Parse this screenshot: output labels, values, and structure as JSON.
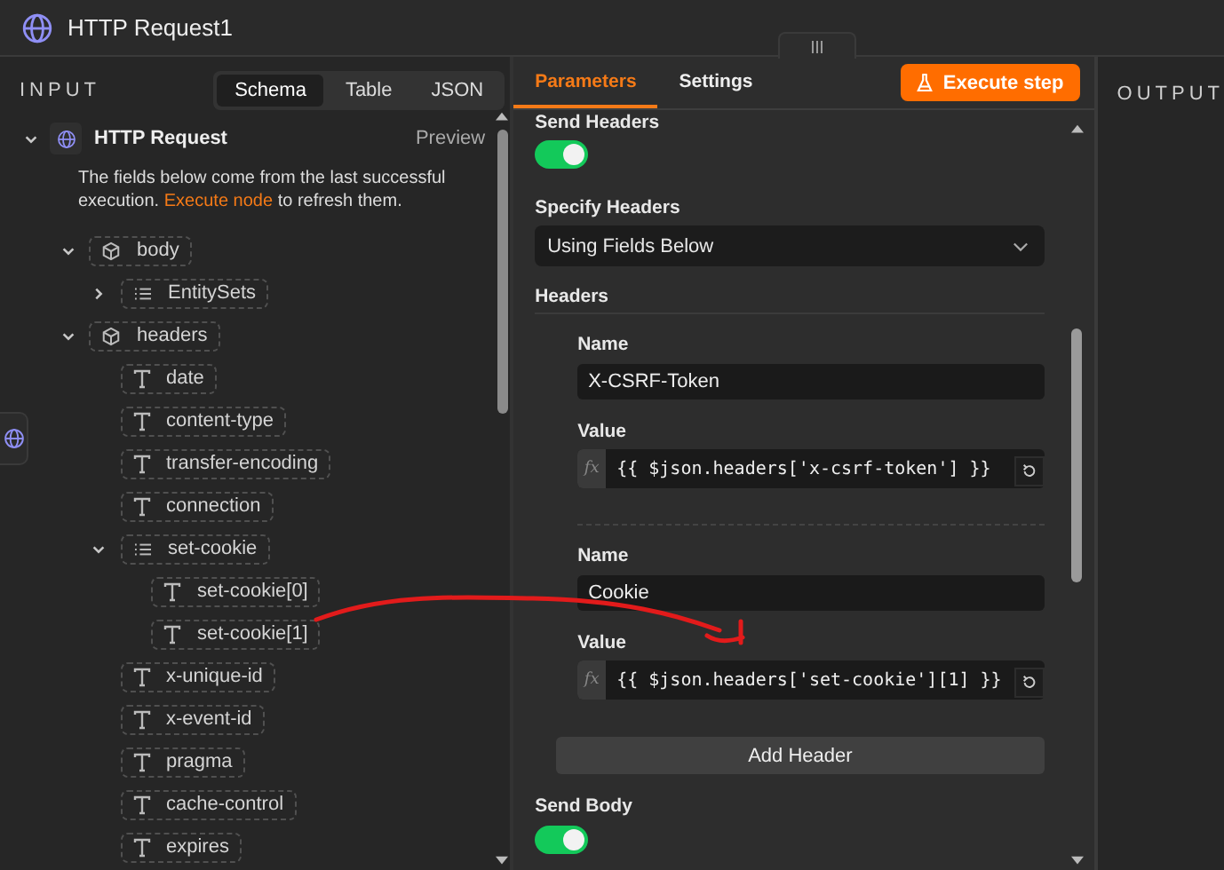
{
  "window": {
    "title": "HTTP Request1"
  },
  "input_panel": {
    "title": "INPUT",
    "view_tabs": [
      {
        "label": "Schema",
        "selected": true
      },
      {
        "label": "Table",
        "selected": false
      },
      {
        "label": "JSON",
        "selected": false
      }
    ],
    "node": {
      "name": "HTTP Request",
      "expanded": true,
      "preview": "Preview"
    },
    "notice": {
      "before": "The fields below come from the last successful execution.",
      "link": "Execute node",
      "after": "to refresh them."
    },
    "fields": [
      {
        "name": "body",
        "kind": "object",
        "expanded": true,
        "children": [
          {
            "name": "EntitySets",
            "kind": "array",
            "expanded": false
          }
        ]
      },
      {
        "name": "headers",
        "kind": "object",
        "expanded": true,
        "children": [
          {
            "name": "date",
            "kind": "string"
          },
          {
            "name": "content-type",
            "kind": "string"
          },
          {
            "name": "transfer-encoding",
            "kind": "string"
          },
          {
            "name": "connection",
            "kind": "string"
          },
          {
            "name": "set-cookie",
            "kind": "array",
            "expanded": true,
            "children": [
              {
                "name": "set-cookie[0]",
                "kind": "string"
              },
              {
                "name": "set-cookie[1]",
                "kind": "string"
              }
            ]
          },
          {
            "name": "x-unique-id",
            "kind": "string"
          },
          {
            "name": "x-event-id",
            "kind": "string"
          },
          {
            "name": "pragma",
            "kind": "string"
          },
          {
            "name": "cache-control",
            "kind": "string"
          },
          {
            "name": "expires",
            "kind": "string"
          }
        ]
      }
    ]
  },
  "parameters_panel": {
    "tabs": [
      {
        "label": "Parameters",
        "selected": true
      },
      {
        "label": "Settings",
        "selected": false
      }
    ],
    "execute_button": "Execute step",
    "send_headers": {
      "label": "Send Headers",
      "on": true
    },
    "specify_headers": {
      "label": "Specify Headers",
      "value": "Using Fields Below"
    },
    "headers_label": "Headers",
    "headers": [
      {
        "name_label": "Name",
        "name": "X-CSRF-Token",
        "value_label": "Value",
        "mode_badge": "fx",
        "value": "{{ $json.headers['x-csrf-token'] }}"
      },
      {
        "name_label": "Name",
        "name": "Cookie",
        "value_label": "Value",
        "mode_badge": "fx",
        "value": "{{ $json.headers['set-cookie'][1] }}"
      }
    ],
    "add_button": "Add Header",
    "send_body": {
      "label": "Send Body",
      "on": true
    }
  },
  "output_panel": {
    "title": "OUTPUT"
  }
}
